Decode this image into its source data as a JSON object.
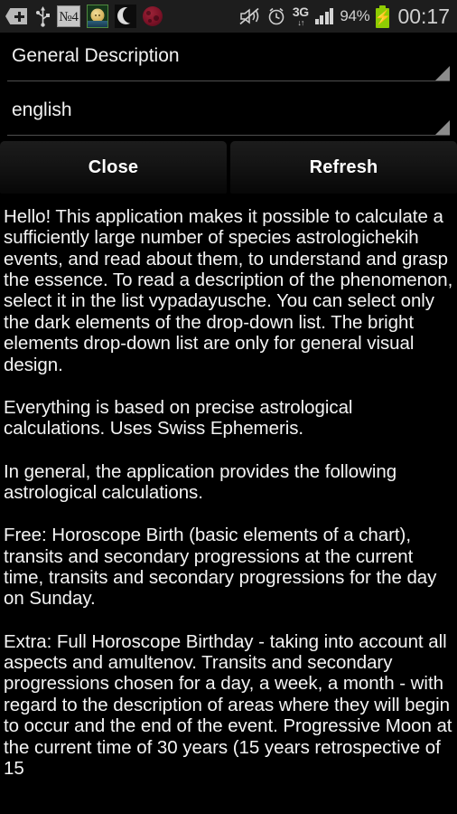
{
  "statusbar": {
    "left_icons": [
      {
        "name": "add-tag-icon",
        "label": "+"
      },
      {
        "name": "usb-icon",
        "label": "USB"
      },
      {
        "name": "number-badge-icon",
        "label": "№4"
      },
      {
        "name": "sun-face-icon",
        "label": "Sun"
      },
      {
        "name": "crescent-moon-icon",
        "label": "Moon"
      },
      {
        "name": "red-moon-icon",
        "label": "Eclipse"
      }
    ],
    "right_icons": [
      {
        "name": "volume-mute-icon",
        "label": "Muted"
      },
      {
        "name": "alarm-clock-icon",
        "label": "Alarm"
      }
    ],
    "network_type": "3G",
    "network_arrows": "↓↑",
    "battery_percent": "94%",
    "battery_state": "charging",
    "clock": "00:17"
  },
  "spinners": [
    {
      "name": "category-spinner",
      "value": "General Description"
    },
    {
      "name": "language-spinner",
      "value": "english"
    }
  ],
  "buttons": {
    "close_label": "Close",
    "refresh_label": "Refresh"
  },
  "content": {
    "paragraphs": [
      "Hello! This application makes it possible to calculate a sufficiently large number of species astrologichekih events, and read about them, to understand and grasp the essence. To read a description of the phenomenon, select it in the list vypadayusche. You can select only the dark elements of the drop-down list. The bright elements drop-down list are only for general visual design.",
      "Everything is based on precise astrological calculations. Uses Swiss Ephemeris.",
      "In general, the application provides the following astrological calculations.",
      "Free: Horoscope Birth (basic elements of a chart), transits and secondary progressions at the current time, transits and secondary progressions for the day on Sunday.",
      "Extra: Full Horoscope Birthday - taking into account all aspects and amultenov. Transits and secondary progressions chosen for a day, a week, a month - with regard to the description of areas where they will begin to occur and the end of the event. Progressive Moon at the current time of 30 years (15 years retrospective of 15"
    ]
  },
  "colors": {
    "background": "#000000",
    "statusbar_bg": "#1d1d1d",
    "text": "#f4f4f4",
    "accent_battery": "#8fcc03",
    "spinner_rule": "#4e4e4e",
    "spinner_triangle": "#8c8c8c"
  }
}
